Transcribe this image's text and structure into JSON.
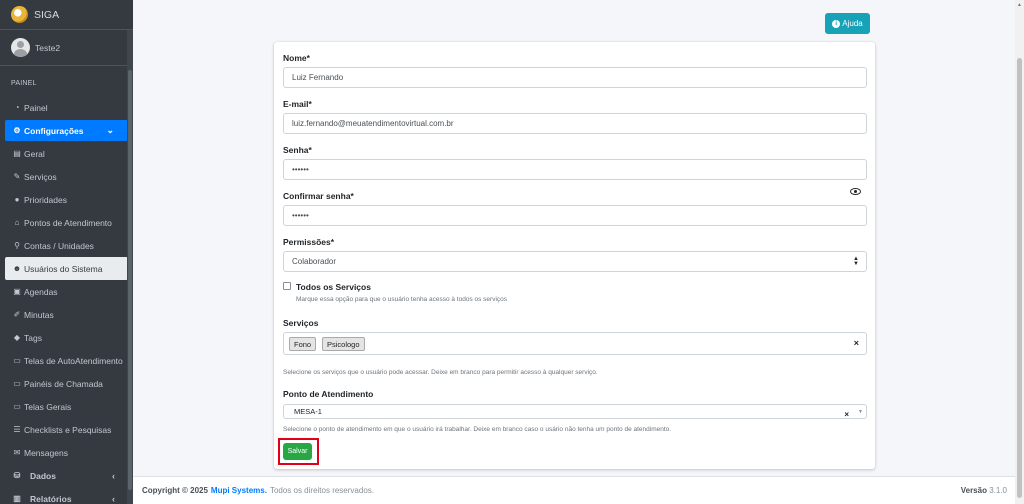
{
  "brand": {
    "name": "SIGA"
  },
  "user": {
    "name": "Teste2"
  },
  "sidebar": {
    "header": "PAINEL",
    "items": [
      {
        "label": "Painel",
        "icon": "dashboard-icon",
        "glyph": "◔"
      },
      {
        "label": "Configurações",
        "icon": "cogs-icon",
        "glyph": "⚙"
      },
      {
        "label": "Geral",
        "icon": "printer-icon",
        "glyph": "▤"
      },
      {
        "label": "Serviços",
        "icon": "wrench-icon",
        "glyph": "✎"
      },
      {
        "label": "Prioridades",
        "icon": "exclamation-icon",
        "glyph": "●"
      },
      {
        "label": "Pontos de Atendimento",
        "icon": "home-icon",
        "glyph": "⌂"
      },
      {
        "label": "Contas / Unidades",
        "icon": "sitemap-icon",
        "glyph": "⚲"
      },
      {
        "label": "Usuários do Sistema",
        "icon": "users-icon",
        "glyph": "☻"
      },
      {
        "label": "Agendas",
        "icon": "calendar-icon",
        "glyph": "▣"
      },
      {
        "label": "Minutas",
        "icon": "edit-icon",
        "glyph": "✐"
      },
      {
        "label": "Tags",
        "icon": "tag-icon",
        "glyph": "◆"
      },
      {
        "label": "Telas de AutoAtendimento",
        "icon": "desktop-icon",
        "glyph": "▭"
      },
      {
        "label": "Painéis de Chamada",
        "icon": "desktop-icon",
        "glyph": "▭"
      },
      {
        "label": "Telas Gerais",
        "icon": "desktop-icon",
        "glyph": "▭"
      },
      {
        "label": "Checklists e Pesquisas",
        "icon": "list-icon",
        "glyph": "☰"
      },
      {
        "label": "Mensagens",
        "icon": "envelope-icon",
        "glyph": "✉"
      },
      {
        "label": "Dados",
        "icon": "database-icon",
        "glyph": "⛁"
      },
      {
        "label": "Relatórios",
        "icon": "chart-icon",
        "glyph": "▥"
      }
    ]
  },
  "toolbar": {
    "help_label": "Ajuda"
  },
  "form": {
    "name_label": "Nome*",
    "name_value": "Luiz Fernando",
    "email_label": "E-mail*",
    "email_value": "luiz.fernando@meuatendimentovirtual.com.br",
    "password_label": "Senha*",
    "password_value": "••••••",
    "confirm_label": "Confirmar senha*",
    "confirm_value": "••••••",
    "permissions_label": "Permissões*",
    "permissions_value": "Colaborador",
    "all_services_label": "Todos os Serviços",
    "all_services_help": "Marque essa opção para que o usuário tenha acesso à todos os serviços",
    "services_label": "Serviços",
    "services_tags": [
      "Fono",
      "Psicologo"
    ],
    "services_help": "Selecione os serviços que o usuário pode acessar. Deixe em branco para permitir acesso à qualquer serviço.",
    "point_label": "Ponto de Atendimento",
    "point_value": "MESA-1",
    "point_help": "Selecione o ponto de atendimento em que o usuário irá trabalhar. Deixe em branco caso o usário não tenha um ponto de atendimento.",
    "save_label": "Salvar"
  },
  "footer": {
    "copyright": "Copyright © 2025",
    "company": "Mupi Systems.",
    "rights": "Todos os direitos reservados.",
    "version_label": "Versão",
    "version_value": "3.1.0"
  }
}
